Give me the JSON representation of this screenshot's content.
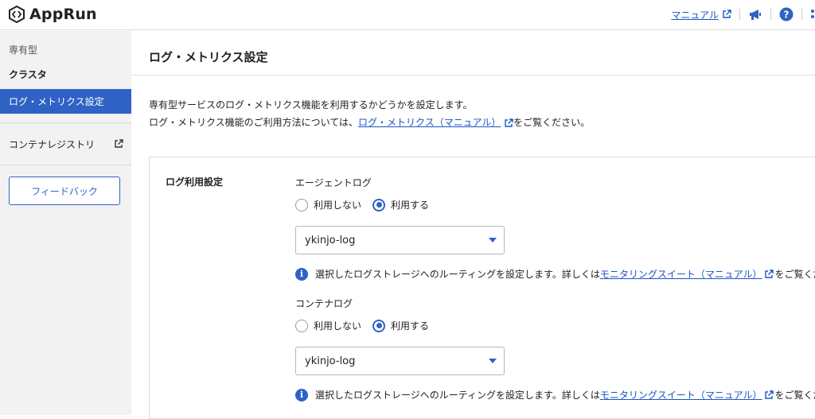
{
  "header": {
    "app_name": "AppRun",
    "manual_link": "マニュアル"
  },
  "sidebar": {
    "group_label": "専有型",
    "items": [
      {
        "label": "クラスタ"
      },
      {
        "label": "ログ・メトリクス設定"
      },
      {
        "label": "コンテナレジストリ"
      }
    ],
    "feedback_button": "フィードバック"
  },
  "main": {
    "title": "ログ・メトリクス設定",
    "desc_line1": "専有型サービスのログ・メトリクス機能を利用するかどうかを設定します。",
    "desc_line2_prefix": "ログ・メトリクス機能のご利用方法については、",
    "desc_link": "ログ・メトリクス（マニュアル）",
    "desc_line2_suffix": "をご覧ください。",
    "card": {
      "label": "ログ利用設定",
      "agent_log": {
        "title": "エージェントログ",
        "option_off": "利用しない",
        "option_on": "利用する",
        "selected": "利用する",
        "select_value": "ykinjo-log",
        "info_prefix": "選択したログストレージへのルーティングを設定します。詳しくは",
        "info_link": "モニタリングスイート（マニュアル）",
        "info_suffix": "をご覧ください。"
      },
      "container_log": {
        "title": "コンテナログ",
        "option_off": "利用しない",
        "option_on": "利用する",
        "selected": "利用する",
        "select_value": "ykinjo-log",
        "info_prefix": "選択したログストレージへのルーティングを設定します。詳しくは",
        "info_link": "モニタリングスイート（マニュアル）",
        "info_suffix": "をご覧ください。"
      }
    }
  },
  "colors": {
    "accent": "#2f62c4",
    "link": "#1a55c6",
    "sidebar_bg": "#f2f2f2"
  },
  "icons": [
    "apprun-logo-icon",
    "external-link-icon",
    "megaphone-icon",
    "help-icon",
    "more-icon",
    "info-icon",
    "chevron-down-icon"
  ]
}
